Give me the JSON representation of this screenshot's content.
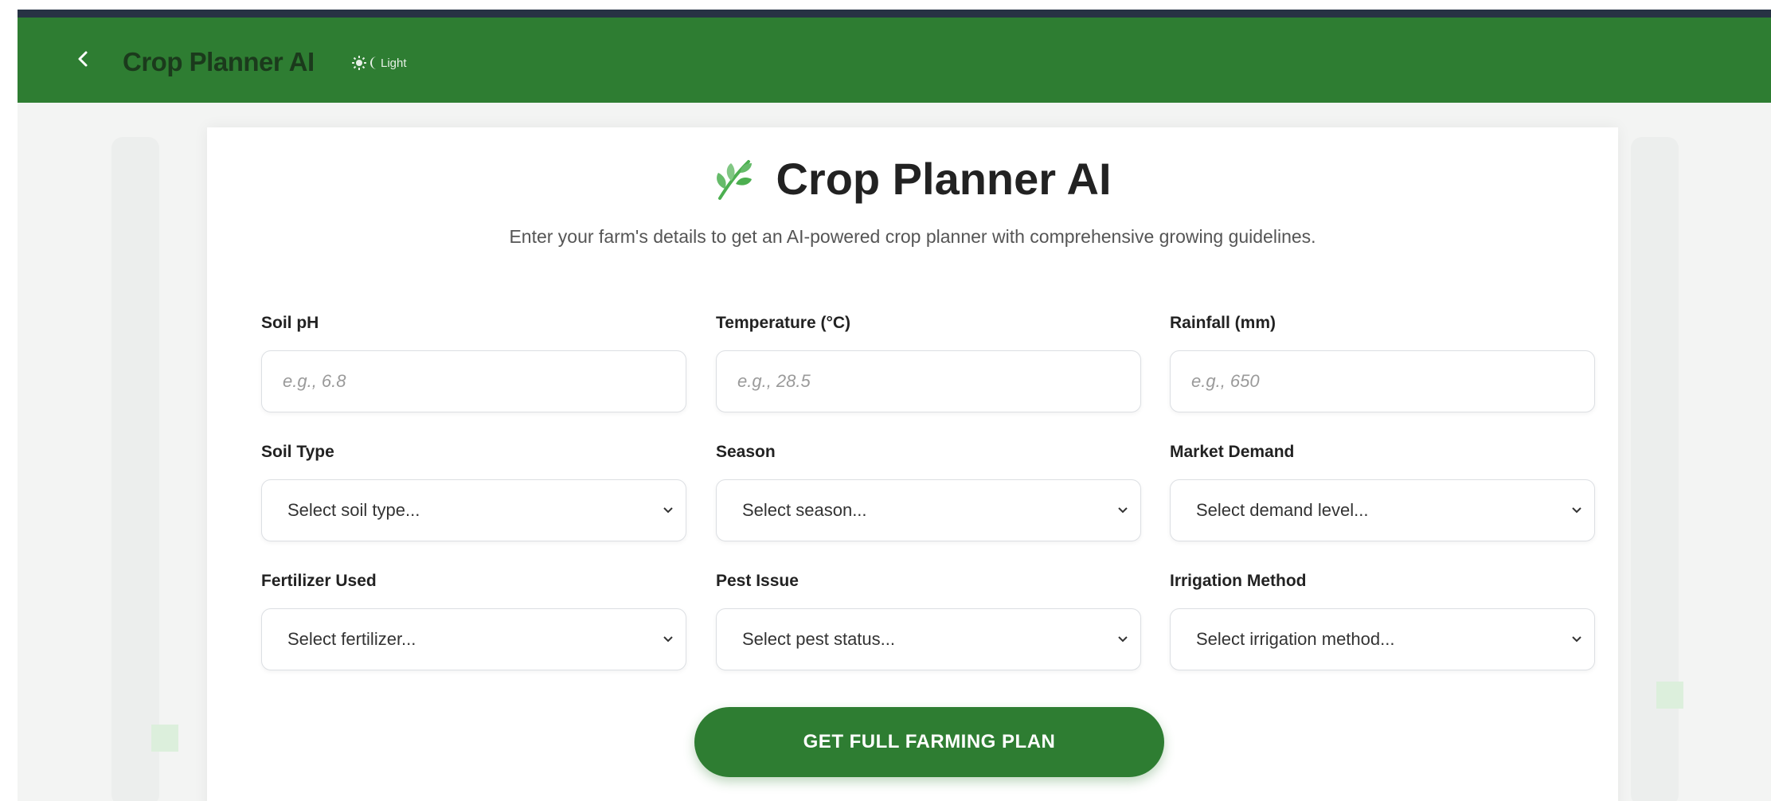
{
  "app_bar": {
    "title": "Crop Planner AI",
    "theme_toggle_label": "Light",
    "icons": {
      "back": "chevron-left-icon",
      "sun": "sun-icon",
      "moon": "moon-icon"
    }
  },
  "card": {
    "heading": "Crop Planner AI",
    "heading_icon": "leaf-sprout-icon",
    "subtitle": "Enter your farm's details to get an AI-powered crop planner with comprehensive growing guidelines."
  },
  "form": {
    "soil_ph": {
      "label": "Soil pH",
      "placeholder": "e.g., 6.8"
    },
    "temperature": {
      "label": "Temperature (°C)",
      "placeholder": "e.g., 28.5"
    },
    "rainfall": {
      "label": "Rainfall (mm)",
      "placeholder": "e.g., 650"
    },
    "soil_type": {
      "label": "Soil Type",
      "value": "Select soil type..."
    },
    "season": {
      "label": "Season",
      "value": "Select season..."
    },
    "market_demand": {
      "label": "Market Demand",
      "value": "Select demand level..."
    },
    "fertilizer": {
      "label": "Fertilizer Used",
      "value": "Select fertilizer..."
    },
    "pest_issue": {
      "label": "Pest Issue",
      "value": "Select pest status..."
    },
    "irrigation": {
      "label": "Irrigation Method",
      "value": "Select irrigation method..."
    },
    "submit_label": "GET FULL FARMING PLAN"
  },
  "colors": {
    "primary_green": "#2e7d32",
    "top_strip": "#273244",
    "background": "#f3f4f3"
  }
}
